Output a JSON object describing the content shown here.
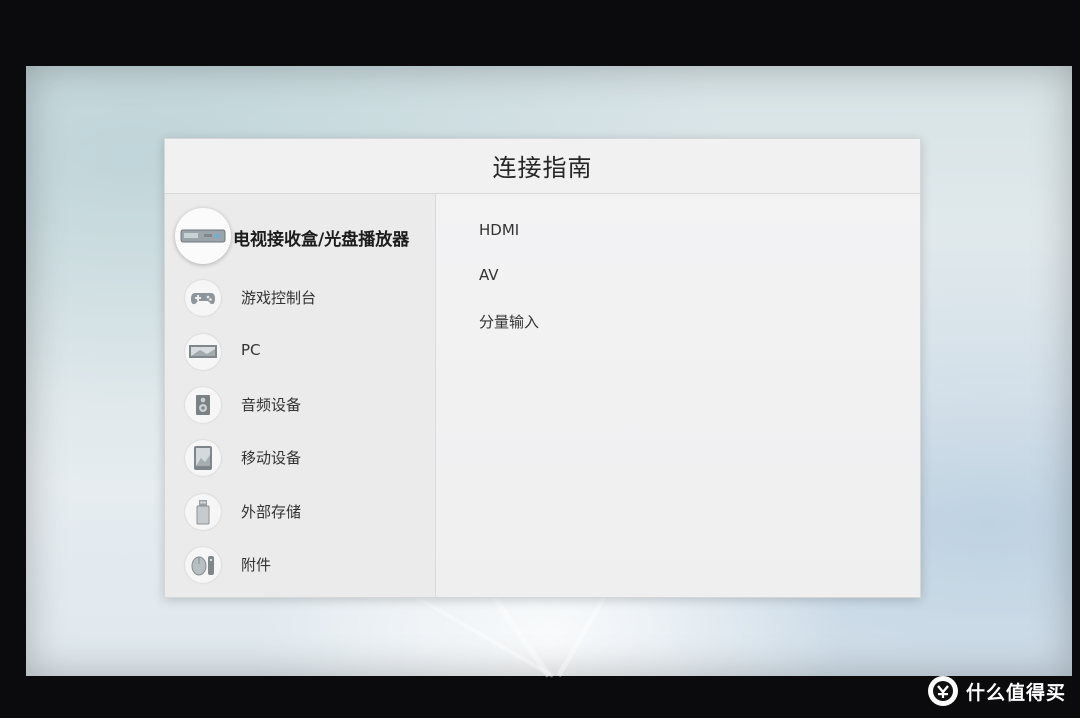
{
  "dialog": {
    "title": "连接指南"
  },
  "devices": [
    {
      "label": "电视接收盒/光盘播放器",
      "icon": "set-top-box-icon",
      "selected": true
    },
    {
      "label": "游戏控制台",
      "icon": "gamepad-icon"
    },
    {
      "label": "PC",
      "icon": "pc-icon"
    },
    {
      "label": "音频设备",
      "icon": "speaker-icon"
    },
    {
      "label": "移动设备",
      "icon": "mobile-device-icon"
    },
    {
      "label": "外部存储",
      "icon": "usb-drive-icon"
    },
    {
      "label": "附件",
      "icon": "accessory-icon"
    }
  ],
  "connections": [
    {
      "label": "HDMI"
    },
    {
      "label": "AV"
    },
    {
      "label": "分量输入"
    }
  ],
  "watermark": {
    "text": "什么值得买",
    "icon": "value-logo-icon"
  }
}
